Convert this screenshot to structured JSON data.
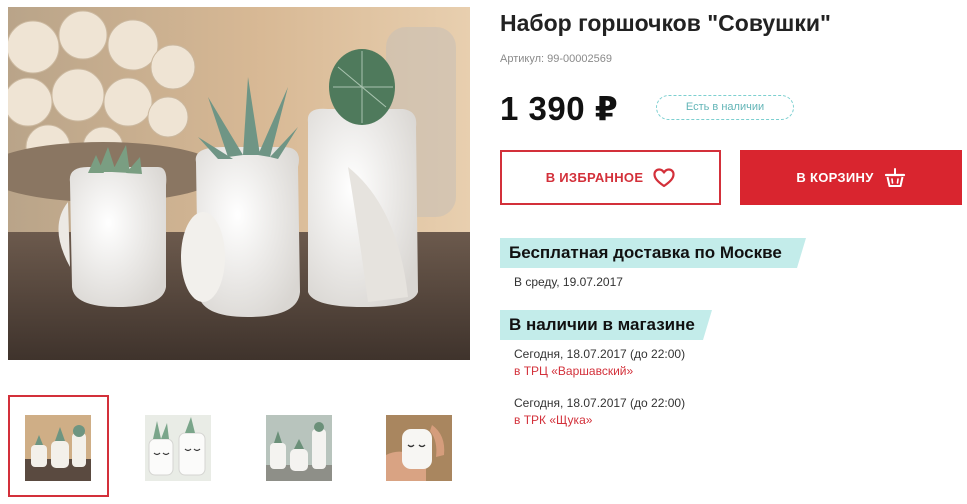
{
  "product": {
    "title": "Набор горшочков \"Совушки\"",
    "sku": "Артикул: 99-00002569",
    "price": "1 390 ₽",
    "stock_badge": "Есть в наличии"
  },
  "actions": {
    "favorite_label": "В ИЗБРАННОЕ",
    "favorite_icon": "heart-icon",
    "cart_label": "В КОРЗИНУ",
    "cart_icon": "basket-icon"
  },
  "delivery": {
    "heading": "Бесплатная доставка по Москве",
    "date": "В среду, 19.07.2017"
  },
  "store_availability": {
    "heading": "В наличии в магазине",
    "stores": [
      {
        "when": "Сегодня, 18.07.2017 (до 22:00)",
        "store": "в ТРЦ «Варшавский»"
      },
      {
        "when": "Сегодня, 18.07.2017 (до 22:00)",
        "store": "в ТРК «Щука»"
      }
    ]
  },
  "gallery": {
    "thumbnail_count": 4,
    "active_thumbnail": 1
  },
  "colors": {
    "accent_red": "#d9252f",
    "badge_teal": "#63b5b7",
    "section_bg": "#c3ecea"
  }
}
